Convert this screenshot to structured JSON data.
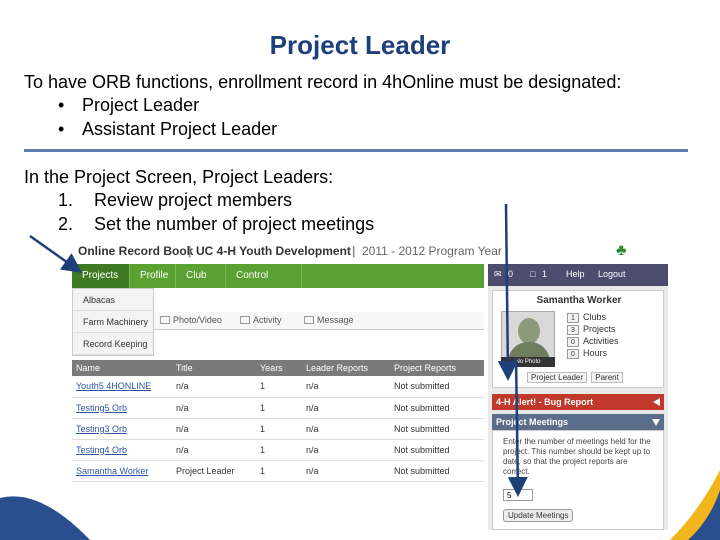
{
  "slide": {
    "title": "Project Leader",
    "intro": "To have ORB functions, enrollment record in 4hOnline must be designated:",
    "designations": [
      "Project Leader",
      "Assistant Project Leader"
    ],
    "intro2": "In the Project Screen, Project Leaders:",
    "steps": [
      {
        "num": "1.",
        "text": "Review project members"
      },
      {
        "num": "2.",
        "text": "Set the number of project meetings"
      }
    ]
  },
  "app": {
    "name": "Online Record Book",
    "club": "UC 4-H Youth Development",
    "year": "2011 - 2012 Program Year",
    "nav": [
      "Projects",
      "Profile",
      "Club Info",
      "Control Panel"
    ],
    "dropdown": [
      "Albacas",
      "Farm Machinery",
      "Record Keeping"
    ],
    "subtabs": [
      "Photo/Video",
      "Activity",
      "Message"
    ],
    "table": {
      "headers": [
        "Name",
        "Title",
        "Years",
        "Leader Reports",
        "Project Reports"
      ],
      "rows": [
        [
          "Youth5 4HONLINE",
          "n/a",
          "1",
          "n/a",
          "Not submitted"
        ],
        [
          "Testing5 Orb",
          "n/a",
          "1",
          "n/a",
          "Not submitted"
        ],
        [
          "Testing3 Orb",
          "n/a",
          "1",
          "n/a",
          "Not submitted"
        ],
        [
          "Testing4 Orb",
          "n/a",
          "1",
          "n/a",
          "Not submitted"
        ],
        [
          "Samantha Worker",
          "Project Leader",
          "1",
          "n/a",
          "Not submitted"
        ]
      ]
    },
    "topright": {
      "mail_count": "0",
      "doc_count": "1",
      "help": "Help",
      "logout": "Logout"
    },
    "user": {
      "name": "Samantha Worker",
      "nophoto": "No Photo",
      "counts": [
        {
          "n": "1",
          "label": "Clubs"
        },
        {
          "n": "3",
          "label": "Projects"
        },
        {
          "n": "0",
          "label": "Activities"
        },
        {
          "n": "0",
          "label": "Hours"
        }
      ],
      "roles": [
        "Project Leader",
        "Parent"
      ]
    },
    "alert": "4-H Alert! - Bug Report",
    "meetings": {
      "title": "Project Meetings",
      "text": "Enter the number of meetings held for the project. This number should be kept up to date, so that the project reports are correct.",
      "value": "5",
      "button": "Update Meetings"
    }
  },
  "colors": {
    "title": "#1f3f7a",
    "nav_green": "#5aa032",
    "alert_red": "#c0392b",
    "rule_blue": "#5b7fb0"
  }
}
